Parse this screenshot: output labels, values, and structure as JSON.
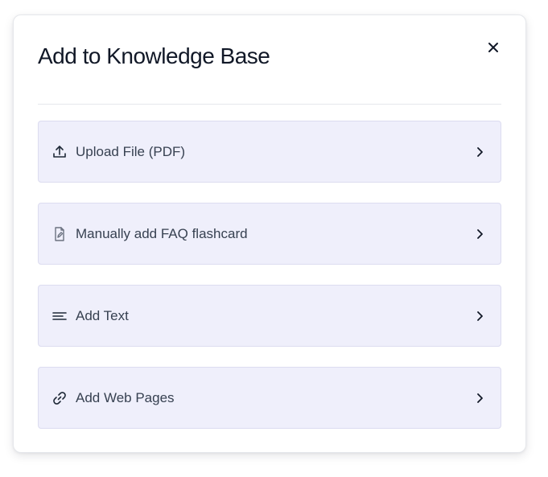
{
  "modal": {
    "title": "Add to Knowledge Base",
    "close_icon": "close-icon"
  },
  "options": [
    {
      "label": "Upload File (PDF)",
      "icon": "upload-icon"
    },
    {
      "label": "Manually add FAQ flashcard",
      "icon": "file-edit-icon"
    },
    {
      "label": "Add Text",
      "icon": "text-lines-icon"
    },
    {
      "label": "Add Web Pages",
      "icon": "link-icon"
    }
  ],
  "colors": {
    "option_background": "#efeffb",
    "option_border": "#dcdcf0",
    "title_text": "#111827",
    "label_text": "#374151"
  }
}
